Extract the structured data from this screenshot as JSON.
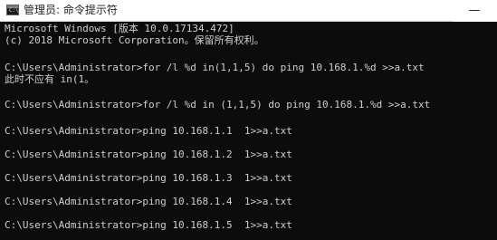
{
  "window": {
    "title": "管理员: 命令提示符",
    "icon_label": "C:\\"
  },
  "titlebar": {
    "minimize_icon": "minimize-icon"
  },
  "terminal": {
    "lines": [
      "Microsoft Windows [版本 10.0.17134.472]",
      "(c) 2018 Microsoft Corporation。保留所有权利。",
      "C:\\Users\\Administrator>for /l %d in(1,1,5) do ping 10.168.1.%d >>a.txt",
      "此时不应有 in(1。",
      "C:\\Users\\Administrator>for /l %d in (1,1,5) do ping 10.168.1.%d >>a.txt",
      "C:\\Users\\Administrator>ping 10.168.1.1  1>>a.txt",
      "C:\\Users\\Administrator>ping 10.168.1.2  1>>a.txt",
      "C:\\Users\\Administrator>ping 10.168.1.3  1>>a.txt",
      "C:\\Users\\Administrator>ping 10.168.1.4  1>>a.txt",
      "C:\\Users\\Administrator>ping 10.168.1.5  1>>a.txt"
    ]
  },
  "colors": {
    "console_background": "#0c0c0c",
    "console_text": "#cfcfcf",
    "titlebar_background": "#ffffff",
    "titlebar_text": "#1f1f1f"
  },
  "icons": {
    "app_icon": "command-prompt-icon",
    "minimize_icon": "minimize-icon"
  }
}
